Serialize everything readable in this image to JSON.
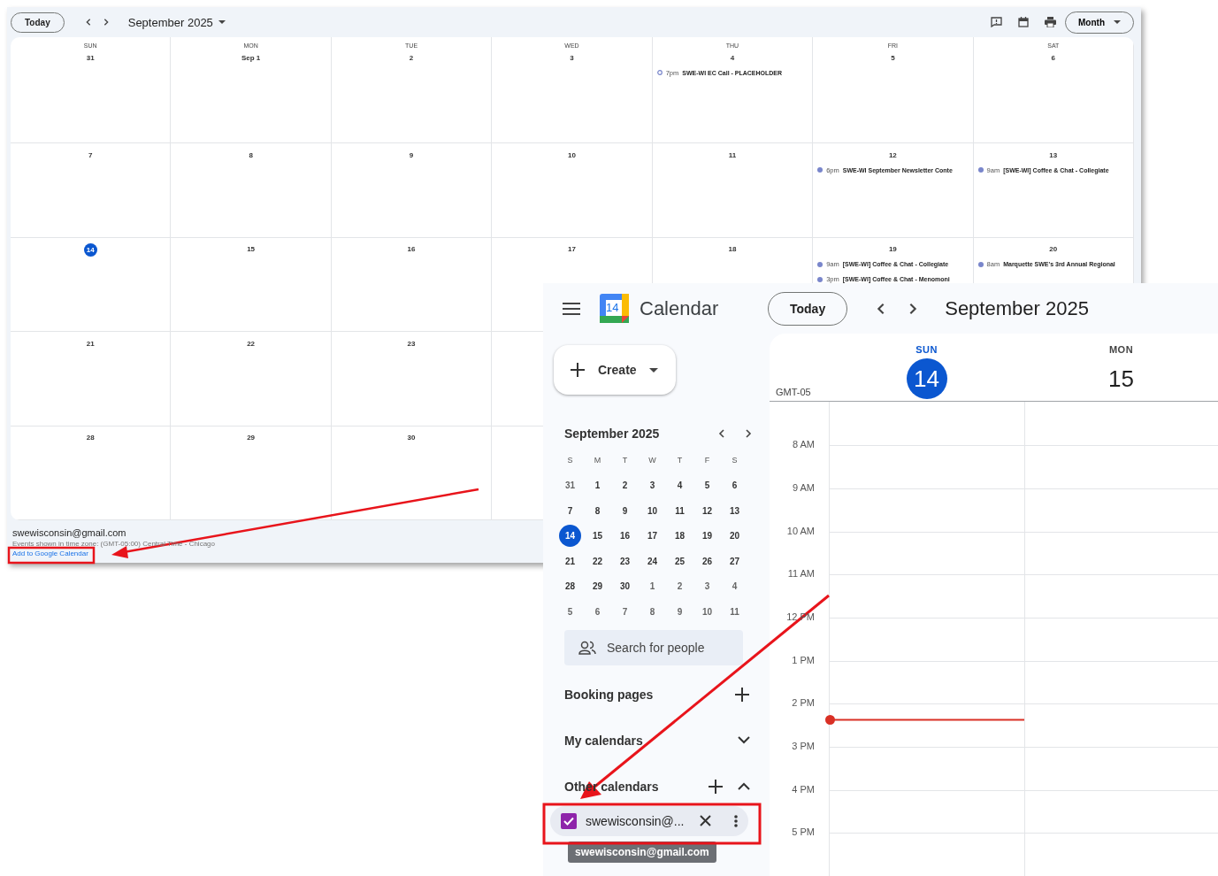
{
  "embedded_calendar": {
    "toolbar": {
      "today_button": "Today",
      "period": "September 2025",
      "view_button": "Month"
    },
    "weeks": [
      [
        {
          "weekday": "SUN",
          "date": "31",
          "today": false
        },
        {
          "weekday": "MON",
          "date": "Sep 1",
          "today": false
        },
        {
          "weekday": "TUE",
          "date": "2",
          "today": false
        },
        {
          "weekday": "WED",
          "date": "3",
          "today": false
        },
        {
          "weekday": "THU",
          "date": "4",
          "today": false,
          "events": [
            {
              "time": "7pm",
              "title": "SWE-WI EC Call - PLACEHOLDER",
              "kind": "hollow"
            }
          ]
        },
        {
          "weekday": "FRI",
          "date": "5",
          "today": false
        },
        {
          "weekday": "SAT",
          "date": "6",
          "today": false
        }
      ],
      [
        {
          "date": "7",
          "today": false
        },
        {
          "date": "8",
          "today": false
        },
        {
          "date": "9",
          "today": false
        },
        {
          "date": "10",
          "today": false
        },
        {
          "date": "11",
          "today": false
        },
        {
          "date": "12",
          "today": false,
          "events": [
            {
              "time": "6pm",
              "title": "SWE-WI September Newsletter Conte",
              "kind": "solid"
            }
          ]
        },
        {
          "date": "13",
          "today": false,
          "events": [
            {
              "time": "9am",
              "title": "[SWE-WI] Coffee & Chat - Collegiate",
              "kind": "solid"
            }
          ]
        }
      ],
      [
        {
          "date": "14",
          "today": true
        },
        {
          "date": "15",
          "today": false
        },
        {
          "date": "16",
          "today": false
        },
        {
          "date": "17",
          "today": false
        },
        {
          "date": "18",
          "today": false
        },
        {
          "date": "19",
          "today": false,
          "events": [
            {
              "time": "9am",
              "title": "[SWE-WI] Coffee & Chat - Collegiate",
              "kind": "solid"
            },
            {
              "time": "3pm",
              "title": "[SWE-WI] Coffee & Chat - Menomoni",
              "kind": "solid"
            }
          ]
        },
        {
          "date": "20",
          "today": false,
          "events": [
            {
              "time": "8am",
              "title": "Marquette SWE's 3rd Annual Regional",
              "kind": "solid"
            }
          ]
        }
      ],
      [
        {
          "date": "21",
          "today": false
        },
        {
          "date": "22",
          "today": false
        },
        {
          "date": "23",
          "today": false
        }
      ],
      [
        {
          "date": "28",
          "today": false
        },
        {
          "date": "29",
          "today": false
        },
        {
          "date": "30",
          "today": false
        }
      ]
    ],
    "footer": {
      "calendar": "swewisconsin@gmail.com",
      "timezone_note": "Events shown in time zone: (GMT-05:00) Central Time - Chicago",
      "link": "Add to Google Calendar"
    }
  },
  "calendar_app": {
    "header": {
      "logo_day": "14",
      "product": "Calendar",
      "today_button": "Today",
      "period": "September 2025"
    },
    "sidebar": {
      "create_button": "Create",
      "mini_calendar": {
        "title": "September 2025",
        "weekdays": [
          "S",
          "M",
          "T",
          "W",
          "T",
          "F",
          "S"
        ],
        "weeks": [
          [
            {
              "day": "31",
              "muted": true,
              "today": false
            },
            {
              "day": "1",
              "muted": false,
              "today": false
            },
            {
              "day": "2",
              "muted": false,
              "today": false
            },
            {
              "day": "3",
              "muted": false,
              "today": false
            },
            {
              "day": "4",
              "muted": false,
              "today": false
            },
            {
              "day": "5",
              "muted": false,
              "today": false
            },
            {
              "day": "6",
              "muted": false,
              "today": false
            }
          ],
          [
            {
              "day": "7",
              "muted": false,
              "today": false
            },
            {
              "day": "8",
              "muted": false,
              "today": false
            },
            {
              "day": "9",
              "muted": false,
              "today": false
            },
            {
              "day": "10",
              "muted": false,
              "today": false
            },
            {
              "day": "11",
              "muted": false,
              "today": false
            },
            {
              "day": "12",
              "muted": false,
              "today": false
            },
            {
              "day": "13",
              "muted": false,
              "today": false
            }
          ],
          [
            {
              "day": "14",
              "muted": false,
              "today": true
            },
            {
              "day": "15",
              "muted": false,
              "today": false
            },
            {
              "day": "16",
              "muted": false,
              "today": false
            },
            {
              "day": "17",
              "muted": false,
              "today": false
            },
            {
              "day": "18",
              "muted": false,
              "today": false
            },
            {
              "day": "19",
              "muted": false,
              "today": false
            },
            {
              "day": "20",
              "muted": false,
              "today": false
            }
          ],
          [
            {
              "day": "21",
              "muted": false,
              "today": false
            },
            {
              "day": "22",
              "muted": false,
              "today": false
            },
            {
              "day": "23",
              "muted": false,
              "today": false
            },
            {
              "day": "24",
              "muted": false,
              "today": false
            },
            {
              "day": "25",
              "muted": false,
              "today": false
            },
            {
              "day": "26",
              "muted": false,
              "today": false
            },
            {
              "day": "27",
              "muted": false,
              "today": false
            }
          ],
          [
            {
              "day": "28",
              "muted": false,
              "today": false
            },
            {
              "day": "29",
              "muted": false,
              "today": false
            },
            {
              "day": "30",
              "muted": false,
              "today": false
            },
            {
              "day": "1",
              "muted": true,
              "today": false
            },
            {
              "day": "2",
              "muted": true,
              "today": false
            },
            {
              "day": "3",
              "muted": true,
              "today": false
            },
            {
              "day": "4",
              "muted": true,
              "today": false
            }
          ],
          [
            {
              "day": "5",
              "muted": true,
              "today": false
            },
            {
              "day": "6",
              "muted": true,
              "today": false
            },
            {
              "day": "7",
              "muted": true,
              "today": false
            },
            {
              "day": "8",
              "muted": true,
              "today": false
            },
            {
              "day": "9",
              "muted": true,
              "today": false
            },
            {
              "day": "10",
              "muted": true,
              "today": false
            },
            {
              "day": "11",
              "muted": true,
              "today": false
            }
          ]
        ]
      },
      "search": {
        "placeholder": "Search for people"
      },
      "sections": [
        {
          "label": "Booking pages",
          "kind": "add"
        },
        {
          "label": "My calendars",
          "kind": "toggle",
          "expanded": false
        },
        {
          "label": "Other calendars",
          "kind": "toggle-add",
          "expanded": true
        }
      ],
      "calendars": [
        {
          "label": "swewisconsin@...",
          "checked": true,
          "color": "#8e24aa"
        }
      ],
      "tooltip": "swewisconsin@gmail.com"
    },
    "day_view": {
      "timezone": "GMT-05",
      "days": [
        {
          "weekday": "SUN",
          "date": "14",
          "today": true
        },
        {
          "weekday": "MON",
          "date": "15",
          "today": false
        }
      ],
      "hours": [
        "8 AM",
        "9 AM",
        "10 AM",
        "11 AM",
        "12 PM",
        "1 PM",
        "2 PM",
        "3 PM",
        "4 PM",
        "5 PM"
      ]
    }
  }
}
